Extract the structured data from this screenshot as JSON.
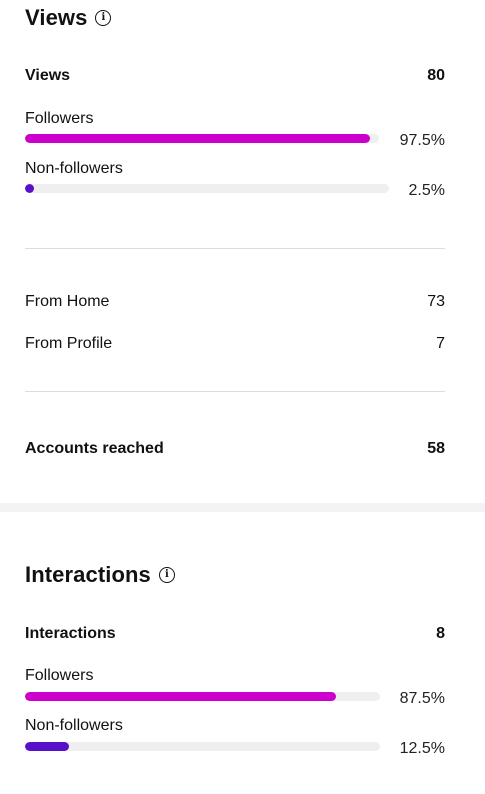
{
  "colors": {
    "followers": "#cc00cc",
    "non_followers": "#5a0fc8"
  },
  "views": {
    "title": "Views",
    "info_icon": "info-icon",
    "total_label": "Views",
    "total_value": "80",
    "followers_label": "Followers",
    "followers_pct": "97.5%",
    "followers_fraction": 0.975,
    "non_followers_label": "Non-followers",
    "non_followers_pct": "2.5%",
    "non_followers_fraction": 0.025,
    "from_home_label": "From Home",
    "from_home_value": "73",
    "from_profile_label": "From Profile",
    "from_profile_value": "7",
    "accounts_reached_label": "Accounts reached",
    "accounts_reached_value": "58"
  },
  "interactions": {
    "title": "Interactions",
    "info_icon": "info-icon",
    "total_label": "Interactions",
    "total_value": "8",
    "followers_label": "Followers",
    "followers_pct": "87.5%",
    "followers_fraction": 0.875,
    "non_followers_label": "Non-followers",
    "non_followers_pct": "12.5%",
    "non_followers_fraction": 0.125
  }
}
